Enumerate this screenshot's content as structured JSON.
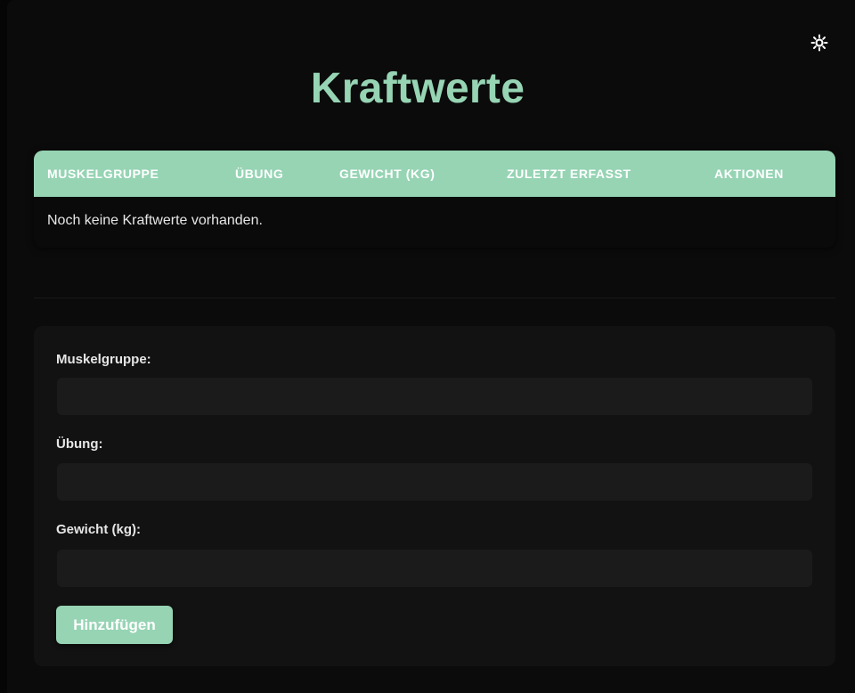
{
  "theme_toggle": {
    "icon": "sun-icon",
    "color": "#ffffff"
  },
  "page": {
    "title": "Kraftwerte"
  },
  "table": {
    "headers": [
      "Muskelgruppe",
      "Übung",
      "Gewicht (kg)",
      "Zuletzt erfasst",
      "Aktionen"
    ],
    "empty_message": "Noch keine Kraftwerte vorhanden."
  },
  "form": {
    "fields": [
      {
        "label": "Muskelgruppe:",
        "value": "",
        "placeholder": ""
      },
      {
        "label": "Übung:",
        "value": "",
        "placeholder": ""
      },
      {
        "label": "Gewicht (kg):",
        "value": "",
        "placeholder": ""
      }
    ],
    "submit_label": "Hinzufügen"
  },
  "colors": {
    "accent": "#96d4b4",
    "background": "#0b0b0b",
    "card": "#121212",
    "input": "#1b1b1b"
  }
}
